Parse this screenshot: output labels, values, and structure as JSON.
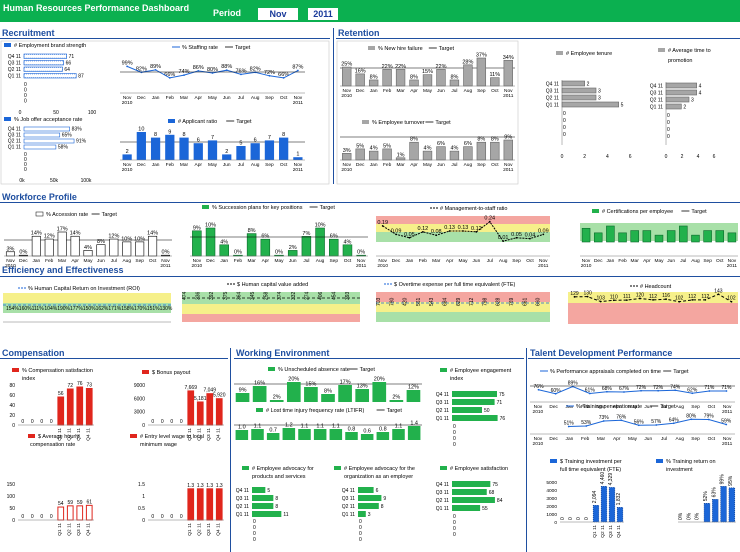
{
  "header": {
    "title": "Human Resources Performance Dashboard",
    "period_label": "Period",
    "month": "Nov",
    "year": "2011"
  },
  "sections": {
    "recruitment": "Recruitment",
    "retention": "Retention",
    "workforce": "Workforce Profile",
    "efficiency": "Efficiency and Effectiveness",
    "compensation": "Compensation",
    "working": "Working Environment",
    "talent": "Talent Development Performance"
  },
  "months": [
    "Nov\n2010",
    "Dec",
    "Jan",
    "Feb",
    "Mar",
    "Apr",
    "May",
    "Jun",
    "Jul",
    "Aug",
    "Sep",
    "Oct",
    "Nov\n2011"
  ],
  "quarters": [
    "Q4 11",
    "Q3 11",
    "Q2 11",
    "Q1 11"
  ],
  "target": "Target",
  "colors": {
    "header": "#0bb050",
    "section": "#1f4fa0",
    "blue": "#1b66d8",
    "gray": "#a6a6a6",
    "green": "#22b14c",
    "red": "#e0261d",
    "band_red": "#f4a6a0",
    "band_yellow": "#f6f08a",
    "band_green": "#a8e0a8"
  },
  "recruitment": {
    "brand": {
      "title": "# Employment brand strength",
      "values": [
        71,
        66,
        64,
        87
      ],
      "axis": [
        "0",
        "50",
        "100"
      ]
    },
    "offer": {
      "title": "% Job offer acceptance rate",
      "values": [
        "83%",
        "65%",
        "91%",
        "58%"
      ],
      "axis": [
        "0k",
        "50k",
        "100k"
      ]
    },
    "staffing": {
      "title": "% Staffing rate",
      "values": [
        99,
        82,
        89,
        66,
        74,
        86,
        80,
        88,
        76,
        82,
        72,
        66,
        87
      ],
      "labels": [
        "99%",
        "82%",
        "89%",
        "66%",
        "74%",
        "86%",
        "80%",
        "88%",
        "76%",
        "82%",
        "72%",
        "66%",
        "87%"
      ]
    },
    "applicant": {
      "title": "# Applicant ratio",
      "values": [
        2,
        10,
        8,
        9,
        8,
        6,
        7,
        2,
        5,
        6,
        7,
        8,
        1
      ],
      "labels": [
        "2",
        "10",
        "8",
        "9",
        "8",
        "6",
        "7",
        "2",
        "5",
        "6",
        "7",
        "8",
        "1"
      ]
    }
  },
  "retention": {
    "newhire": {
      "title": "% New hire failure",
      "values": [
        25,
        16,
        8,
        22,
        22,
        8,
        15,
        22,
        8,
        28,
        37,
        11,
        34
      ],
      "labels": [
        "25%",
        "16%",
        "8%",
        "22%",
        "22%",
        "8%",
        "15%",
        "22%",
        "8%",
        "28%",
        "37%",
        "11%",
        "34%"
      ]
    },
    "turnover": {
      "title": "% Employee turnover",
      "values": [
        3,
        5,
        4,
        5,
        1,
        8,
        4,
        6,
        4,
        6,
        8,
        8,
        9
      ],
      "labels": [
        "3%",
        "5%",
        "4%",
        "5%",
        "1%",
        "8%",
        "4%",
        "6%",
        "4%",
        "6%",
        "8%",
        "8%",
        "9%"
      ]
    },
    "tenure": {
      "title": "# Employee tenure",
      "values": [
        2,
        3,
        3,
        5
      ],
      "axis": [
        "0",
        "2",
        "4",
        "6"
      ]
    },
    "timetopromo": {
      "title": "# Average time to promotion",
      "values": [
        4,
        4,
        3,
        2
      ],
      "axis": [
        "0",
        "2",
        "4",
        "6"
      ]
    }
  },
  "workforce": {
    "accession": {
      "title": "% Accession rate",
      "values": [
        3,
        0,
        14,
        12,
        17,
        14,
        4,
        8,
        12,
        10,
        10,
        14,
        0
      ],
      "labels": [
        "3%",
        "0%",
        "14%",
        "12%",
        "17%",
        "14%",
        "4%",
        "8%",
        "12%",
        "10%",
        "10%",
        "14%",
        "0%"
      ]
    },
    "succession": {
      "title": "% Succession plans for key positions",
      "values": [
        9,
        10,
        4,
        0,
        8,
        6,
        0,
        2,
        7,
        10,
        6,
        4,
        0
      ],
      "labels": [
        "9%",
        "10%",
        "4%",
        "0%",
        "8%",
        "6%",
        "0%",
        "2%",
        "7%",
        "10%",
        "6%",
        "4%",
        "0%"
      ]
    },
    "mgmt": {
      "title": "# Management-to-staff ratio",
      "values": [
        0.19,
        0.09,
        0.05,
        0.12,
        0.08,
        0.13,
        0.13,
        0.12,
        0.24,
        0.01,
        0.05,
        0.04,
        0.09
      ],
      "labels": [
        "0.19",
        "0.09",
        "0.05",
        "0.12",
        "0.08",
        "0.13",
        "0.13",
        "0.12",
        "0.24",
        "0.01",
        "0.05",
        "0.04",
        "0.09"
      ]
    },
    "certs": {
      "title": "# Certifications per employee",
      "values": [
        6,
        4,
        7,
        4,
        5,
        5,
        3,
        5,
        7,
        3,
        5,
        5,
        4
      ]
    }
  },
  "efficiency": {
    "roi": {
      "title": "% Human Capital Return on Investment (ROI)",
      "labels": [
        "154%",
        "160%",
        "111%",
        "104%",
        "190%",
        "177%",
        "150%",
        "162%",
        "171%",
        "158%",
        "170%",
        "151%",
        "130%"
      ]
    },
    "hcva": {
      "title": "$ Human capital value added",
      "labels": [
        "474",
        "336",
        "392",
        "375",
        "364",
        "345",
        "258",
        "374",
        "332",
        "274",
        "406",
        "454",
        "393"
      ]
    },
    "overtime": {
      "title": "$ Overtime expense per full time equivalent (FTE)",
      "labels": [
        "703",
        "780",
        "420",
        "561",
        "543",
        "684",
        "629",
        "712",
        "798",
        "628",
        "769",
        "661",
        "660"
      ]
    },
    "headcount": {
      "title": "# Headcount",
      "values": [
        129,
        130,
        103,
        110,
        111,
        120,
        112,
        116,
        102,
        112,
        112,
        143,
        102
      ],
      "labels": [
        "129",
        "130",
        "103",
        "110",
        "111",
        "120",
        "112",
        "116",
        "102",
        "112",
        "112",
        "143",
        "102"
      ]
    }
  },
  "compensation": {
    "satisfaction": {
      "title": "% Compensation satisfaction index",
      "values": [
        0,
        0,
        0,
        0,
        56,
        72,
        76,
        73
      ],
      "labels": [
        "0",
        "0",
        "0",
        "0",
        "56",
        "72",
        "76",
        "73"
      ],
      "axis": [
        "0",
        "20",
        "40",
        "60",
        "80"
      ]
    },
    "bonus": {
      "title": "$ Bonus payout",
      "values": [
        0,
        0,
        0,
        0,
        7669,
        5181,
        7049,
        5920
      ],
      "labels": [
        "0",
        "0",
        "0",
        "0",
        "7,669",
        "5,181",
        "7,049",
        "5,920"
      ],
      "axis": [
        "0",
        "3000",
        "6000",
        "9000"
      ]
    },
    "hourly": {
      "title": "$ Average hourly compensation rate",
      "values": [
        0,
        0,
        0,
        0,
        54,
        59,
        59,
        61
      ],
      "labels": [
        "0",
        "0",
        "0",
        "0",
        "54",
        "59",
        "59",
        "61"
      ],
      "axis": [
        "0",
        "50",
        "100",
        "150"
      ]
    },
    "entry": {
      "title": "# Entry level wage to local minimum wage",
      "values": [
        0,
        0,
        0,
        0,
        1.3,
        1.3,
        1.3,
        1.3
      ],
      "labels": [
        "0",
        "0",
        "0",
        "0",
        "1.3",
        "1.3",
        "1.3",
        "1.3"
      ],
      "axis": [
        "0",
        "0.5",
        "1",
        "1.5"
      ]
    },
    "qlabels": [
      "Q1 11",
      "Q2 11",
      "Q3 11",
      "Q4 11"
    ]
  },
  "working": {
    "absence": {
      "title": "% Unscheduled absence rate",
      "values": [
        9,
        16,
        2,
        20,
        15,
        8,
        17,
        13,
        20,
        2,
        12
      ],
      "labels": [
        "9%",
        "16%",
        "2%",
        "20%",
        "15%",
        "8%",
        "17%",
        "13%",
        "20%",
        "2%",
        "12%"
      ]
    },
    "ltifr": {
      "title": "# Lost time injury frequency rate (LTIFR)",
      "values": [
        1.0,
        1.1,
        0.7,
        1.2,
        1.1,
        1.1,
        1.1,
        0.8,
        0.6,
        0.8,
        1.1,
        1.4
      ],
      "labels": [
        "1.0",
        "1.1",
        "0.7",
        "1.2",
        "1.1",
        "1.1",
        "1.1",
        "0.8",
        "0.6",
        "0.8",
        "1.1",
        "1.4"
      ]
    },
    "engagement": {
      "title": "# Employee engagement index",
      "values": [
        75,
        71,
        50,
        76
      ]
    },
    "advocacy_products": {
      "title": "# Employee advocacy for products and services",
      "values": [
        5,
        8,
        8,
        11
      ]
    },
    "advocacy_org": {
      "title": "# Employee advocacy for the organization as an employer",
      "values": [
        6,
        9,
        8,
        3
      ]
    },
    "satisfaction": {
      "title": "# Employee satisfaction",
      "values": [
        75,
        68,
        84,
        55
      ]
    }
  },
  "talent": {
    "appraisals": {
      "title": "% Performance appraisals completed on time",
      "labels": [
        "76%",
        "60%",
        "89%",
        "61%",
        "68%",
        "67%",
        "72%",
        "72%",
        "74%",
        "62%",
        "71%",
        "71%"
      ]
    },
    "penetration": {
      "title": "% Training penetration rate",
      "labels": [
        "51%",
        "53%",
        "73%",
        "76%",
        "56%",
        "57%",
        "64%",
        "80%",
        "79%",
        "59%"
      ]
    },
    "investment": {
      "title": "$ Training investment per full time equivalent (FTE)",
      "values": [
        0,
        0,
        0,
        0,
        2094,
        4460,
        4329,
        1832
      ],
      "labels": [
        "0",
        "0",
        "0",
        "0",
        "2,094",
        "4,460",
        "4,329",
        "1,832"
      ],
      "axis": [
        "0",
        "1000",
        "2000",
        "3000",
        "4000",
        "5000"
      ]
    },
    "return": {
      "title": "% Training return on investment",
      "values": [
        0,
        0,
        0,
        52,
        63,
        99,
        95
      ],
      "labels": [
        "0%",
        "0%",
        "0%",
        "52%",
        "63%",
        "99%",
        "95%"
      ]
    }
  }
}
